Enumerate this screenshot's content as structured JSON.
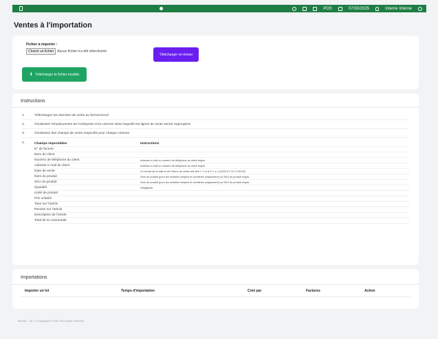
{
  "topbar": {
    "pos_label": "POS",
    "date": "07/30/2025",
    "user": "Interne Interne"
  },
  "page_title": "Ventes à l'importation",
  "upload": {
    "file_label": "Fichier à importer :",
    "choose_button": "Choisir un fichier",
    "no_file_text": "Aucun fichier n'a été sélectionné",
    "upload_button": "Télécharger et réviser",
    "template_button": "Télécharger le fichier modèle"
  },
  "instructions": {
    "title": "Instructions",
    "steps": [
      {
        "num": "1.",
        "text": "Téléchargez les données de vente au format Excel"
      },
      {
        "num": "2.",
        "text": "Choisissez l'emplacement de l'entreprise et la colonne selon laquelle les lignes de vente seront regroupées"
      },
      {
        "num": "3.",
        "text": "Choisissez des champs de vente respectifs pour chaque colonne"
      }
    ],
    "step4_num": "4.",
    "table_headers": {
      "field": "Champs importables",
      "instructions": "Instructions"
    },
    "fields": [
      {
        "name": "N° de facture",
        "note": ""
      },
      {
        "name": "Nom du client",
        "note": ""
      },
      {
        "name": "Numéro de téléphone du client",
        "note": "Adresse e-mail ou numéro de téléphone du client requis"
      },
      {
        "name": "Adresse e-mail du client",
        "note": "Adresse e-mail ou numéro de téléphone du client requis"
      },
      {
        "name": "Date de vente",
        "note": "Le format de la date et de l'heure de vente doit être « Y-m-d H :i :s » (2020-07-15 17:45:32)"
      },
      {
        "name": "Nom du produit",
        "note": "Nom du produit (pour les modèles simples et combinés uniquement) ou SKU du produit requis"
      },
      {
        "name": "SKU du produit",
        "note": "Nom du produit (pour les modèles simples et combinés uniquement) ou SKU du produit requis"
      },
      {
        "name": "Quantité",
        "note": "Obligatoire"
      },
      {
        "name": "Unité de produit",
        "note": ""
      },
      {
        "name": "Prix unitaire",
        "note": ""
      },
      {
        "name": "Taxe sur l'article",
        "note": ""
      },
      {
        "name": "Remise sur l'article",
        "note": ""
      },
      {
        "name": "Description de l'article",
        "note": ""
      },
      {
        "name": "Total de la commande",
        "note": ""
      }
    ]
  },
  "imports": {
    "title": "Importations",
    "columns": [
      "Importer un lot",
      "Temps d'importation",
      "Créé par",
      "Factures",
      "Action"
    ]
  },
  "footer": "Mindfyi - V6.7 | Copyright © 2025 Tous droits réservés.",
  "colors": {
    "topbar": "#1e7d44",
    "upload_button": "#6a1ef0",
    "template_button": "#1fa463"
  }
}
